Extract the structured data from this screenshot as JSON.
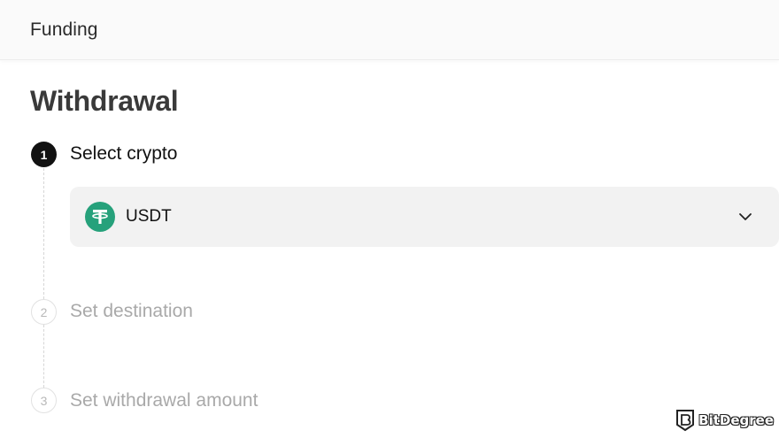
{
  "header": {
    "title": "Funding"
  },
  "page": {
    "title": "Withdrawal"
  },
  "steps": [
    {
      "number": "1",
      "label": "Select crypto",
      "state": "active"
    },
    {
      "number": "2",
      "label": "Set destination",
      "state": "inactive"
    },
    {
      "number": "3",
      "label": "Set withdrawal amount",
      "state": "inactive"
    }
  ],
  "crypto_select": {
    "selected": "USDT",
    "icon": "tether-icon",
    "icon_color": "#26a17b"
  },
  "watermark": {
    "text": "BitDegree"
  },
  "colors": {
    "active_step": "#111111",
    "inactive_text": "#a9a9a9",
    "select_bg": "#f2f2f2"
  }
}
